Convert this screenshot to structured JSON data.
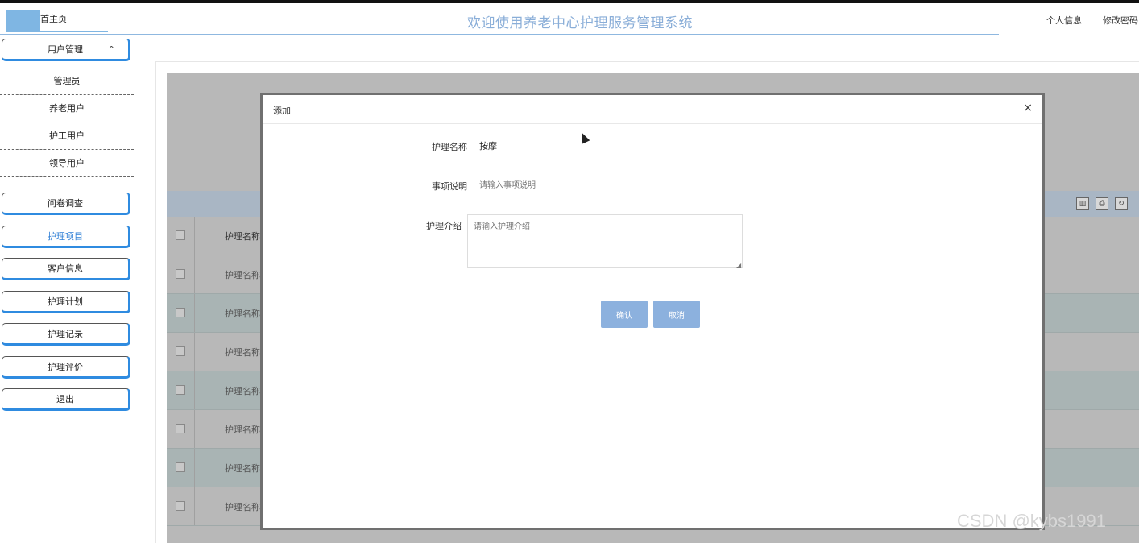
{
  "header": {
    "home_tab": "首主页",
    "title": "欢迎使用养老中心护理服务管理系统",
    "profile_link": "个人信息",
    "password_link": "修改密码"
  },
  "sidebar": {
    "user_management": "用户管理",
    "sub_items": [
      "管理员",
      "养老用户",
      "护工用户",
      "领导用户"
    ],
    "menu": [
      "问卷调查",
      "护理项目",
      "客户信息",
      "护理计划",
      "护理记录",
      "护理评价",
      "退出"
    ],
    "active": "护理项目"
  },
  "table": {
    "header_col": "护理名称",
    "cell_text": "护理名称"
  },
  "modal": {
    "title": "添加",
    "name_label": "护理名称",
    "name_value": "按摩",
    "desc_label": "事项说明",
    "desc_placeholder": "请输入事项说明",
    "intro_label": "护理介绍",
    "intro_placeholder": "请输入护理介绍",
    "confirm": "确认",
    "cancel": "取消",
    "close": "×"
  },
  "watermark": "CSDN @kybs1991"
}
